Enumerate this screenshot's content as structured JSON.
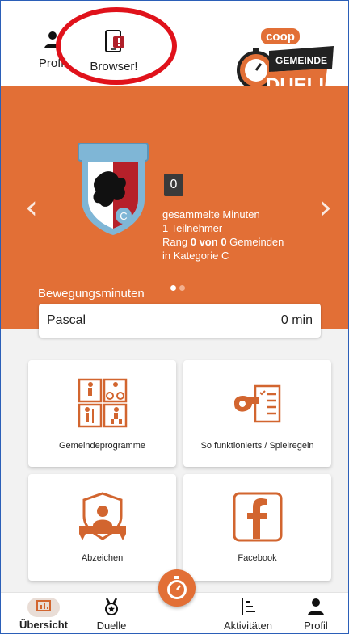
{
  "header": {
    "profil_label": "Profil",
    "browser_label": "Browser!",
    "logo": {
      "brand": "coop",
      "line1": "GEMEINDE",
      "line2": "DUELL"
    }
  },
  "hero": {
    "minutes_value": "0",
    "minutes_label": "gesammelte Minuten",
    "participants_count": "1",
    "participants_label": "Teilnehmer",
    "rank_prefix": "Rang",
    "rank_value": "0",
    "rank_of": "von",
    "rank_total": "0",
    "rank_suffix": "Gemeinden",
    "category_line": "in Kategorie C",
    "crest_badge": "C",
    "carousel": {
      "count": 2,
      "active": 0
    },
    "section_label": "Bewegungsminuten",
    "user_row": {
      "name": "Pascal",
      "value": "0 min"
    }
  },
  "tiles": [
    {
      "label": "Gemeindeprogramme",
      "icon": "sports-grid-icon"
    },
    {
      "label": "So funktionierts / Spielregeln",
      "icon": "whistle-rules-icon"
    },
    {
      "label": "Abzeichen",
      "icon": "badge-person-icon"
    },
    {
      "label": "Facebook",
      "icon": "facebook-icon"
    }
  ],
  "bottom_nav": [
    {
      "label": "Übersicht",
      "icon": "chart-icon",
      "active": true
    },
    {
      "label": "Duelle",
      "icon": "medal-icon"
    },
    {
      "label": "Aktivitäten",
      "icon": "list-icon"
    },
    {
      "label": "Profil",
      "icon": "person-icon"
    }
  ],
  "colors": {
    "accent": "#e26f36",
    "annotation_red": "#e0121b",
    "active_pill": "#e9ddd6"
  }
}
